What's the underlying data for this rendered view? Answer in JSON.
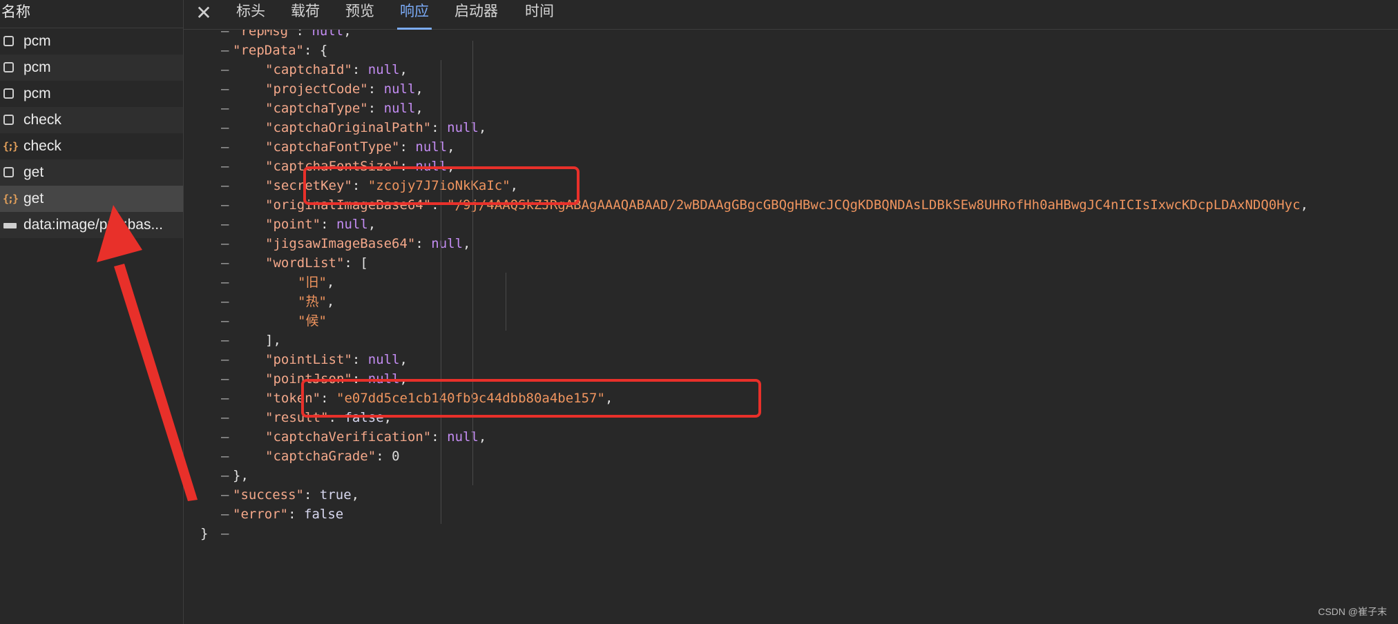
{
  "sidebar": {
    "header": "名称",
    "requests": [
      {
        "name": "pcm",
        "icon": "document-icon"
      },
      {
        "name": "pcm",
        "icon": "document-icon"
      },
      {
        "name": "pcm",
        "icon": "document-icon"
      },
      {
        "name": "check",
        "icon": "document-icon"
      },
      {
        "name": "check",
        "icon": "json-braces-icon"
      },
      {
        "name": "get",
        "icon": "document-icon"
      },
      {
        "name": "get",
        "icon": "json-braces-icon",
        "selected": true
      },
      {
        "name": "data:image/png;bas...",
        "icon": "image-data-icon"
      }
    ]
  },
  "tabs": {
    "close_glyph": "✕",
    "items": [
      "标头",
      "载荷",
      "预览",
      "响应",
      "启动器",
      "时间"
    ],
    "active": "响应"
  },
  "json_lines": [
    {
      "k": "repMsg",
      "v": "null"
    },
    {
      "k": "repData",
      "open": "{"
    },
    {
      "k": "captchaId",
      "v": "null"
    },
    {
      "k": "projectCode",
      "v": "null"
    },
    {
      "k": "captchaType",
      "v": "null"
    },
    {
      "k": "captchaOriginalPath",
      "v": "null"
    },
    {
      "k": "captchaFontType",
      "v": "null"
    },
    {
      "k": "captchaFontSize",
      "v": "null"
    },
    {
      "k": "secretKey",
      "v": "\"zcojy7J7ioNkKaIc\""
    },
    {
      "k": "originalImageBase64",
      "v": "\"/9j/4AAQSkZJRgABAgAAAQABAAD/2wBDAAgGBgcGBQgHBwcJCQgKDBQNDAsLDBkSEw8UHRofHh0aHBwgJC4nICIsIxwcKDcpLDAxNDQ0Hyc"
    },
    {
      "k": "point",
      "v": "null"
    },
    {
      "k": "jigsawImageBase64",
      "v": "null"
    },
    {
      "k": "wordList",
      "open": "["
    },
    {
      "item": "\"旧\""
    },
    {
      "item": "\"热\""
    },
    {
      "item": "\"候\""
    },
    {
      "close": "],"
    },
    {
      "k": "pointList",
      "v": "null"
    },
    {
      "k": "pointJson",
      "v": "null"
    },
    {
      "k": "token",
      "v": "\"e07dd5ce1cb140fb9c44dbb80a4be157\""
    },
    {
      "k": "result",
      "v": "false"
    },
    {
      "k": "captchaVerification",
      "v": "null"
    },
    {
      "k": "captchaGrade",
      "v": "0",
      "last": true
    },
    {
      "close": "},"
    },
    {
      "k": "success",
      "v": "true"
    },
    {
      "k": "error",
      "v": "false",
      "last": true
    },
    {
      "close": "}"
    }
  ],
  "fold_marker": "–",
  "watermark": "CSDN @崔子末",
  "colors": {
    "background": "#282828",
    "key": "#f4a88a",
    "string": "#f0955f",
    "null": "#c38cf2",
    "active_tab": "#7cacf8",
    "highlight_box": "#e8302a"
  }
}
